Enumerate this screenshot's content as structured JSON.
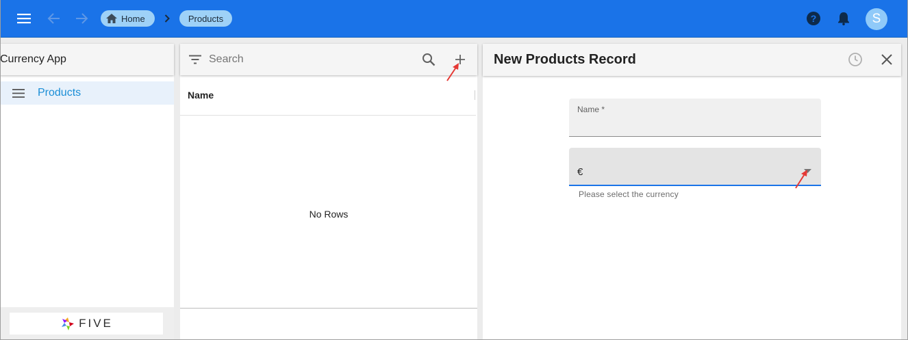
{
  "topbar": {
    "home_label": "Home",
    "products_label": "Products",
    "avatar_letter": "S",
    "color": "#1a73e8"
  },
  "sidebar": {
    "title": "Currency App",
    "items": [
      {
        "label": "Products",
        "icon": "menu-lines-icon"
      }
    ],
    "logo_text": "FIVE"
  },
  "list": {
    "search_placeholder": "Search",
    "column_header": "Name",
    "empty_text": "No Rows"
  },
  "form": {
    "title": "New Products Record",
    "name_label": "Name *",
    "name_value": "",
    "currency_value": "€",
    "currency_helper": "Please select the currency",
    "accent_color": "#1a73e8"
  }
}
